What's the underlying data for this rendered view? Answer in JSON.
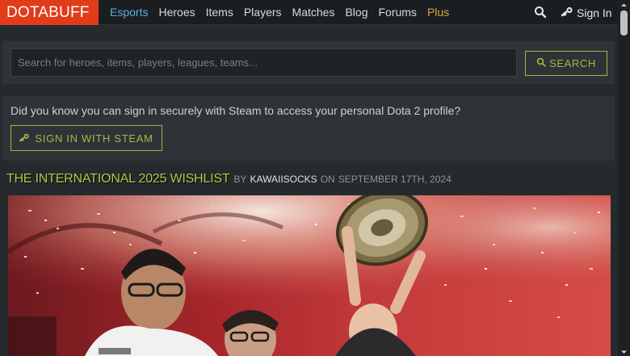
{
  "nav": {
    "logo": "DOTABUFF",
    "links": [
      {
        "label": "Esports"
      },
      {
        "label": "Heroes"
      },
      {
        "label": "Items"
      },
      {
        "label": "Players"
      },
      {
        "label": "Matches"
      },
      {
        "label": "Blog"
      },
      {
        "label": "Forums"
      },
      {
        "label": "Plus"
      }
    ],
    "signin_label": "Sign In",
    "icons": {
      "search": "search-icon",
      "steam": "steam-icon"
    }
  },
  "search": {
    "placeholder": "Search for heroes, items, players, leagues, teams...",
    "value": "",
    "button_label": "SEARCH"
  },
  "steam": {
    "message": "Did you know you can sign in securely with Steam to access your personal Dota 2 profile?",
    "button_label": "SIGN IN WITH STEAM"
  },
  "article": {
    "title": "THE INTERNATIONAL 2025 WISHLIST",
    "by": "BY",
    "author": "KAWAIISOCKS",
    "on": "ON",
    "date": "SEPTEMBER 17TH, 2024"
  },
  "colors": {
    "brand": "#e23b1a",
    "accent_green": "#a8b63f",
    "link_blue": "#5ab0da",
    "plus_gold": "#d4a738",
    "background": "#252a2e",
    "panel": "#2d3337"
  }
}
